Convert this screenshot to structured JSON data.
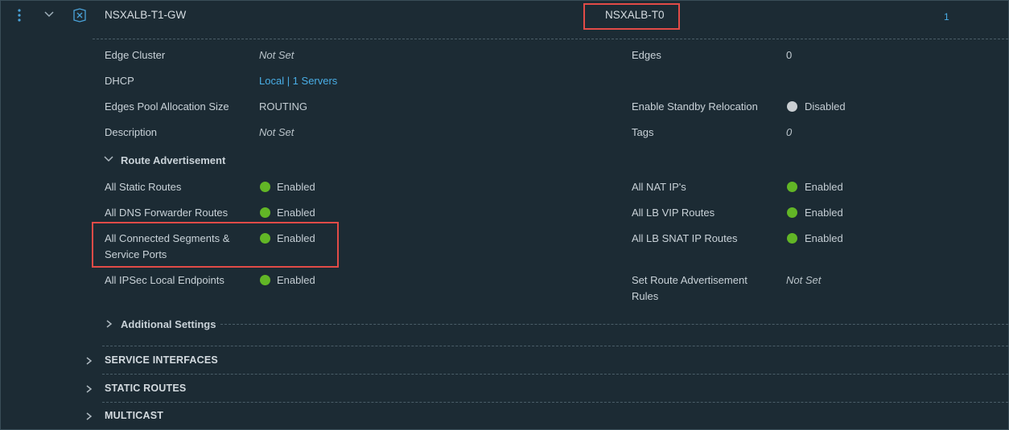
{
  "gateway": {
    "name": "NSXALB-T1-GW",
    "linked_tier0": "NSXALB-T0",
    "count": "1",
    "icons": {
      "menu": "vertical-ellipsis-icon",
      "expand": "chevron-down-icon",
      "type": "router-icon"
    }
  },
  "details": {
    "left": [
      {
        "label": "Edge Cluster",
        "value": "Not Set"
      },
      {
        "label": "DHCP",
        "value": "Local | 1 Servers"
      },
      {
        "label": "Edges Pool Allocation Size",
        "value": "ROUTING"
      },
      {
        "label": "Description",
        "value": "Not Set"
      }
    ],
    "right": [
      {
        "label": "Edges",
        "value": "0"
      },
      {
        "label": "Enable Standby Relocation",
        "value": "Disabled",
        "status_color": "#c9ced2"
      },
      {
        "label": "Tags",
        "value": "0"
      }
    ]
  },
  "route_advertisement": {
    "title": "Route Advertisement",
    "left": [
      {
        "label": "All Static Routes",
        "value": "Enabled"
      },
      {
        "label": "All DNS Forwarder Routes",
        "value": "Enabled"
      },
      {
        "label_line1": "All Connected Segments &",
        "label_line2": "Service Ports",
        "value": "Enabled"
      },
      {
        "label": "All IPSec Local Endpoints",
        "value": "Enabled"
      }
    ],
    "right": [
      {
        "label": "All NAT IP's",
        "value": "Enabled"
      },
      {
        "label": "All LB VIP Routes",
        "value": "Enabled"
      },
      {
        "label": "All LB SNAT IP Routes",
        "value": "Enabled"
      },
      {
        "label_line1": "Set Route Advertisement",
        "label_line2": "Rules",
        "value": "Not Set"
      }
    ],
    "enabled_color": "#62b626"
  },
  "additional_settings": {
    "title": "Additional Settings"
  },
  "sections": [
    "SERVICE INTERFACES",
    "STATIC ROUTES",
    "MULTICAST"
  ],
  "highlight_color": "#e24b47"
}
